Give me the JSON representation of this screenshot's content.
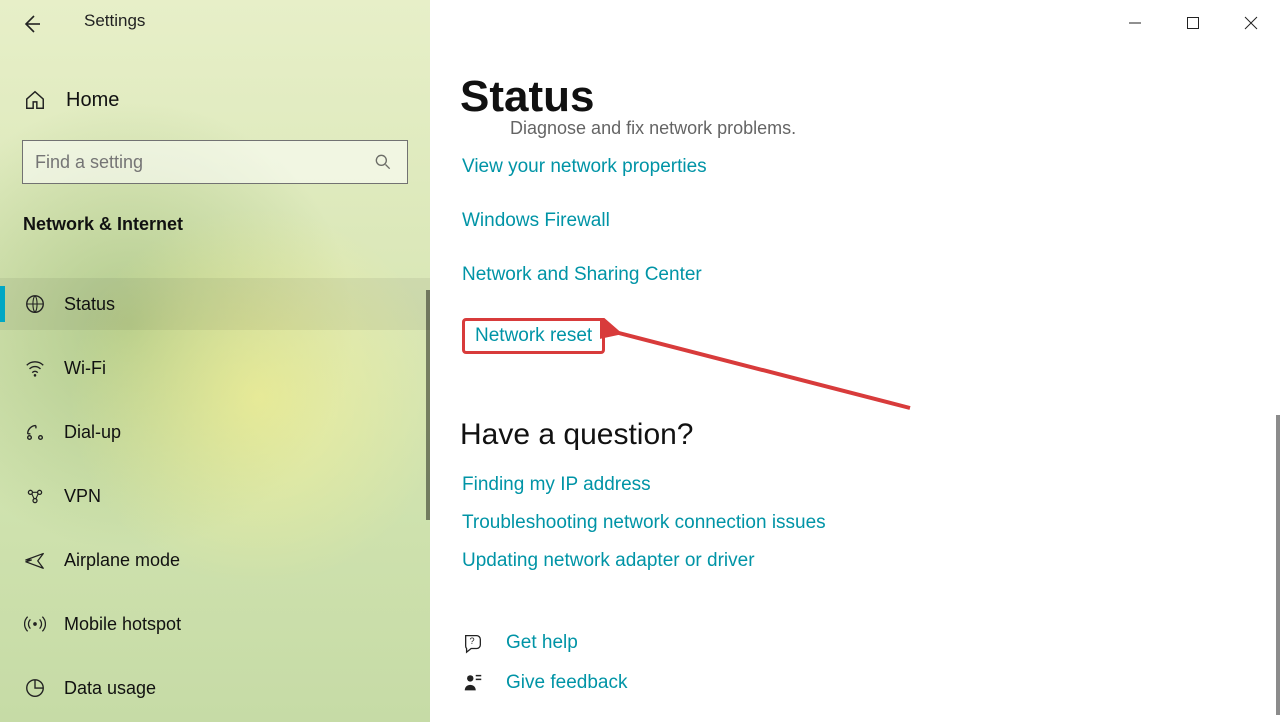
{
  "app": {
    "title": "Settings"
  },
  "sidebar": {
    "home": "Home",
    "search_placeholder": "Find a setting",
    "group": "Network & Internet",
    "items": [
      {
        "label": "Status"
      },
      {
        "label": "Wi-Fi"
      },
      {
        "label": "Dial-up"
      },
      {
        "label": "VPN"
      },
      {
        "label": "Airplane mode"
      },
      {
        "label": "Mobile hotspot"
      },
      {
        "label": "Data usage"
      }
    ]
  },
  "main": {
    "title": "Status",
    "clipped": "Diagnose and fix network problems.",
    "links": [
      "View your network properties",
      "Windows Firewall",
      "Network and Sharing Center",
      "Network reset"
    ],
    "question_heading": "Have a question?",
    "question_links": [
      "Finding my IP address",
      "Troubleshooting network connection issues",
      "Updating network adapter or driver"
    ],
    "footer": {
      "help": "Get help",
      "feedback": "Give feedback"
    }
  }
}
